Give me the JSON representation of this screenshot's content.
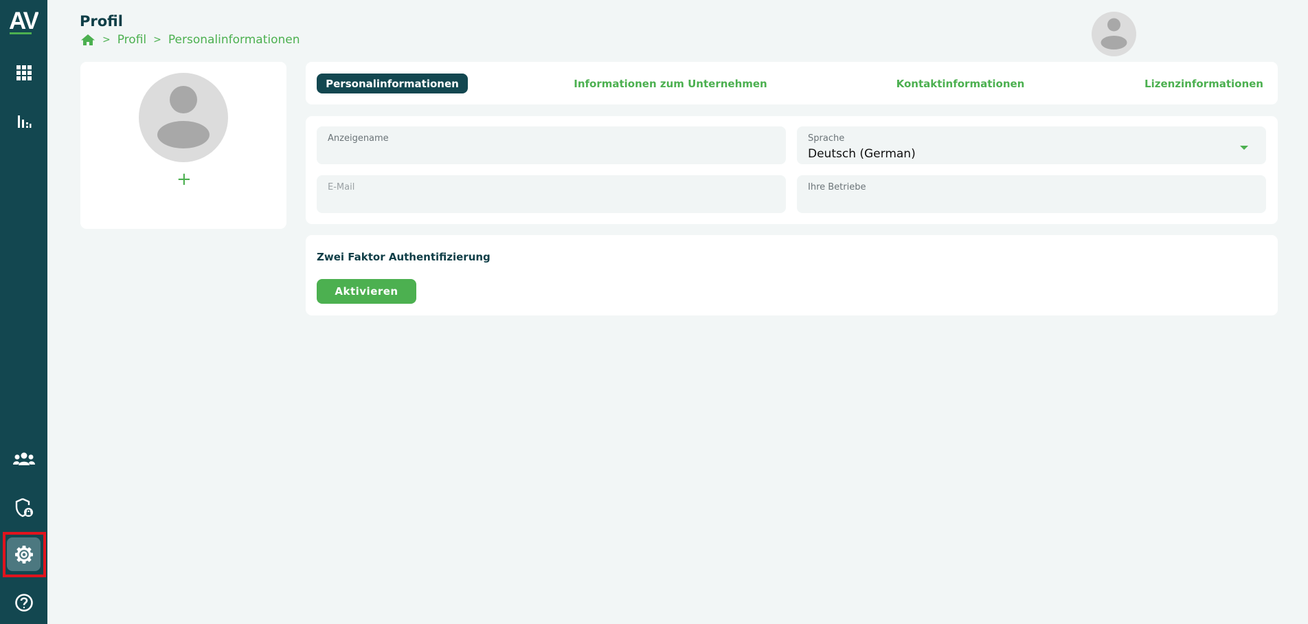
{
  "sidebar": {
    "logo_text": "AV",
    "items": [
      {
        "name": "apps-grid-icon"
      },
      {
        "name": "bar-chart-icon"
      },
      {
        "name": "users-group-icon"
      },
      {
        "name": "shield-lock-icon"
      },
      {
        "name": "gear-icon"
      },
      {
        "name": "help-icon"
      }
    ]
  },
  "header": {
    "title": "Profil",
    "breadcrumb": {
      "home_icon": "home-icon",
      "separator": ">",
      "items": [
        "Profil",
        "Personalinformationen"
      ]
    }
  },
  "tabs": [
    {
      "label": "Personalinformationen",
      "active": true
    },
    {
      "label": "Informationen zum Unternehmen",
      "active": false
    },
    {
      "label": "Kontaktinformationen",
      "active": false
    },
    {
      "label": "Lizenzinformationen",
      "active": false
    }
  ],
  "form": {
    "display_name": {
      "label": "Anzeigename",
      "value": ""
    },
    "language": {
      "label": "Sprache",
      "value": "Deutsch (German)"
    },
    "email": {
      "label": "E-Mail",
      "value": ""
    },
    "businesses": {
      "label": "Ihre Betriebe",
      "value": ""
    }
  },
  "avatar_card": {
    "add_label": "+"
  },
  "two_factor": {
    "title": "Zwei Faktor Authentifizierung",
    "button_label": "Aktivieren"
  },
  "colors": {
    "sidebar": "#134750",
    "accent": "#4cb050",
    "background": "#f2f6f6",
    "highlight": "#e0141e"
  }
}
